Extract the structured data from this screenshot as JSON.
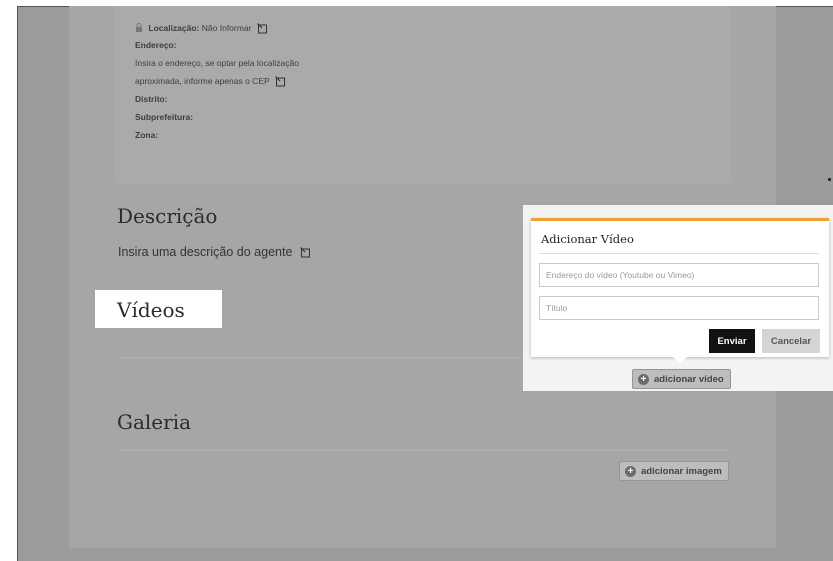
{
  "address": {
    "location_label": "Localização:",
    "location_value": "Não Informar",
    "street_label": "Endereço:",
    "street_hint_line1": "Insira o endereço, se optar pela localização",
    "street_hint_line2": "aproximada, informe apenas o CEP",
    "district_label": "Distrito:",
    "subprefecture_label": "Subprefeitura:",
    "zone_label": "Zona:"
  },
  "description": {
    "title": "Descrição",
    "placeholder": "Insira uma descrição do agente"
  },
  "videos": {
    "title": "Vídeos",
    "add_label": "adicionar vídeo"
  },
  "gallery": {
    "title": "Galeria",
    "add_label": "adicionar imagem"
  },
  "video_popup": {
    "title": "Adicionar Vídeo",
    "url_placeholder": "Endereço do vídeo (Youtube ou Vimeo)",
    "title_placeholder": "Título",
    "submit_label": "Enviar",
    "cancel_label": "Cancelar",
    "accent_color": "#f0a030"
  }
}
